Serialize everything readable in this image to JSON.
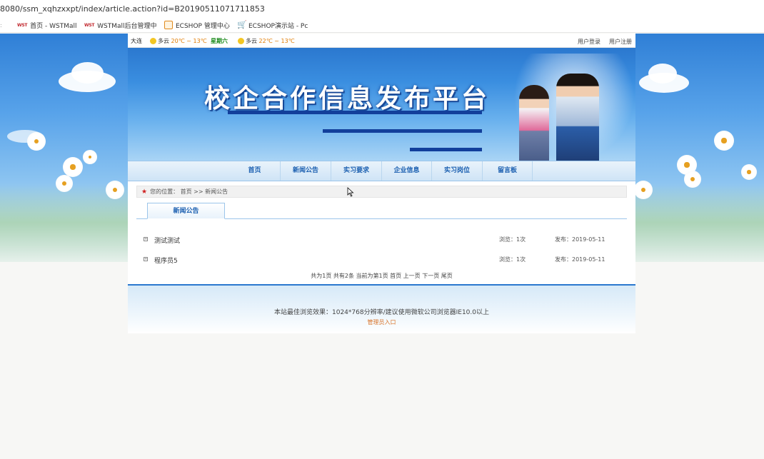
{
  "browser": {
    "url": "8080/ssm_xqhzxxpt/index/article.action?id=B20190511071711853",
    "bookmarks": [
      {
        "prefix": "⭐",
        "label": "",
        "icon": "star-icon"
      },
      {
        "prefix": "WST",
        "label": "首页 - WSTMall",
        "icon": "wst-logo"
      },
      {
        "prefix": "WST",
        "label": "WSTMall后台管理中",
        "icon": "wst-logo"
      },
      {
        "prefix": "",
        "label": "ECSHOP 管理中心",
        "icon": "ecshop-box-icon"
      },
      {
        "prefix": "",
        "label": "ECSHOP演示站 - Pc",
        "icon": "ecshop-cart-icon"
      }
    ]
  },
  "top": {
    "city": "大连",
    "weather1_cond": "多云",
    "weather1_temp": "20℃ ~ 13℃",
    "weekday": "星期六",
    "weather2_cond": "多云",
    "weather2_temp": "22℃ ~ 13℃",
    "login": "用户登录",
    "register": "用户注册"
  },
  "banner": {
    "title": "校企合作信息发布平台"
  },
  "nav": {
    "items": [
      "首页",
      "新闻公告",
      "实习要求",
      "企业信息",
      "实习岗位",
      "留言板"
    ]
  },
  "breadcrumb": {
    "label": "您的位置：",
    "home": "首页",
    "sep": ">>",
    "current": "新闻公告"
  },
  "tab": {
    "label": "新闻公告"
  },
  "articles": [
    {
      "title": "测试测试",
      "views": "浏览：1次",
      "date": "发布：2019-05-11"
    },
    {
      "title": "程序员5",
      "views": "浏览：1次",
      "date": "发布：2019-05-11"
    }
  ],
  "pager": {
    "text": "共为1页 共有2条 当前为第1页 首页 上一页 下一页 尾页"
  },
  "footer": {
    "note": "本站最佳浏览效果：1024*768分辨率/建议使用微软公司浏览器IE10.0以上",
    "admin": "管理员入口"
  },
  "colors": {
    "accent": "#1b5fb0",
    "banner": "#2b78cf",
    "temp": "#e17b00",
    "weekday": "#1a8a1a",
    "admin": "#d9742a"
  }
}
